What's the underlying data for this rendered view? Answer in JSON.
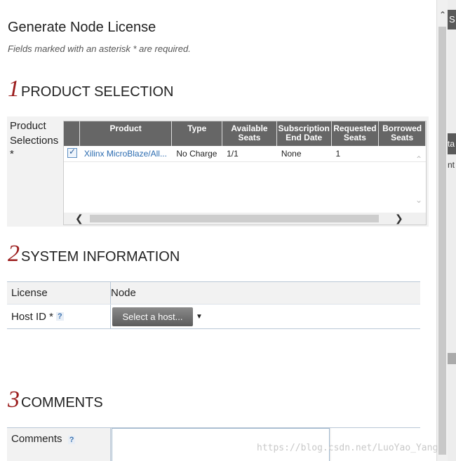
{
  "page": {
    "title": "Generate Node License",
    "required_note": "Fields marked with an asterisk * are required."
  },
  "sections": {
    "product": {
      "num": "1",
      "label": "PRODUCT SELECTION"
    },
    "system": {
      "num": "2",
      "label": "SYSTEM INFORMATION"
    },
    "comments": {
      "num": "3",
      "label": "COMMENTS"
    }
  },
  "product_selection": {
    "field_label": "Product Selections",
    "required_mark": "*",
    "columns": [
      "Product",
      "Type",
      "Available Seats",
      "Subscription End Date",
      "Requested Seats",
      "Borrowed Seats"
    ],
    "rows": [
      {
        "checked": true,
        "product": "Xilinx MicroBlaze/All...",
        "type": "No Charge",
        "available": "1/1",
        "end_date": "None",
        "requested": "1",
        "borrowed": ""
      }
    ]
  },
  "system_info": {
    "license_label": "License",
    "license_value": "Node",
    "host_label": "Host ID *",
    "help": "?",
    "host_button": "Select a host..."
  },
  "comments": {
    "label": "Comments",
    "help": "?",
    "value": ""
  },
  "background": {
    "right_tab_text": "S",
    "right_tab2_text": "ta",
    "right_snippet": "nt"
  },
  "watermark": "https://blog.csdn.net/LuoYao_Yang"
}
